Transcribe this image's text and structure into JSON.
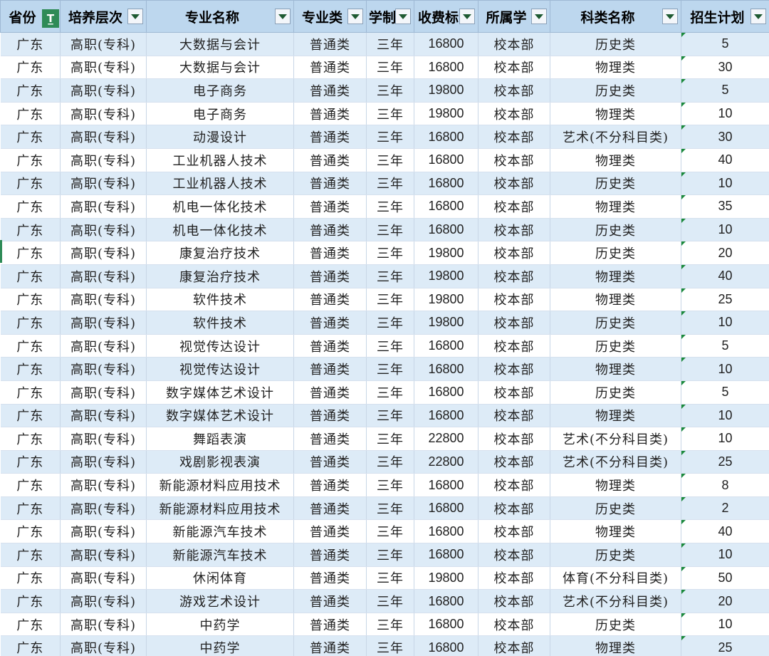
{
  "headers": [
    "省份",
    "培养层次",
    "专业名称",
    "专业类",
    "学制",
    "收费标",
    "所属学",
    "科类名称",
    "招生计划"
  ],
  "rows": [
    [
      "广东",
      "高职(专科)",
      "大数据与会计",
      "普通类",
      "三年",
      "16800",
      "校本部",
      "历史类",
      "5"
    ],
    [
      "广东",
      "高职(专科)",
      "大数据与会计",
      "普通类",
      "三年",
      "16800",
      "校本部",
      "物理类",
      "30"
    ],
    [
      "广东",
      "高职(专科)",
      "电子商务",
      "普通类",
      "三年",
      "19800",
      "校本部",
      "历史类",
      "5"
    ],
    [
      "广东",
      "高职(专科)",
      "电子商务",
      "普通类",
      "三年",
      "19800",
      "校本部",
      "物理类",
      "10"
    ],
    [
      "广东",
      "高职(专科)",
      "动漫设计",
      "普通类",
      "三年",
      "16800",
      "校本部",
      "艺术(不分科目类)",
      "30"
    ],
    [
      "广东",
      "高职(专科)",
      "工业机器人技术",
      "普通类",
      "三年",
      "16800",
      "校本部",
      "物理类",
      "40"
    ],
    [
      "广东",
      "高职(专科)",
      "工业机器人技术",
      "普通类",
      "三年",
      "16800",
      "校本部",
      "历史类",
      "10"
    ],
    [
      "广东",
      "高职(专科)",
      "机电一体化技术",
      "普通类",
      "三年",
      "16800",
      "校本部",
      "物理类",
      "35"
    ],
    [
      "广东",
      "高职(专科)",
      "机电一体化技术",
      "普通类",
      "三年",
      "16800",
      "校本部",
      "历史类",
      "10"
    ],
    [
      "广东",
      "高职(专科)",
      "康复治疗技术",
      "普通类",
      "三年",
      "19800",
      "校本部",
      "历史类",
      "20"
    ],
    [
      "广东",
      "高职(专科)",
      "康复治疗技术",
      "普通类",
      "三年",
      "19800",
      "校本部",
      "物理类",
      "40"
    ],
    [
      "广东",
      "高职(专科)",
      "软件技术",
      "普通类",
      "三年",
      "19800",
      "校本部",
      "物理类",
      "25"
    ],
    [
      "广东",
      "高职(专科)",
      "软件技术",
      "普通类",
      "三年",
      "19800",
      "校本部",
      "历史类",
      "10"
    ],
    [
      "广东",
      "高职(专科)",
      "视觉传达设计",
      "普通类",
      "三年",
      "16800",
      "校本部",
      "历史类",
      "5"
    ],
    [
      "广东",
      "高职(专科)",
      "视觉传达设计",
      "普通类",
      "三年",
      "16800",
      "校本部",
      "物理类",
      "10"
    ],
    [
      "广东",
      "高职(专科)",
      "数字媒体艺术设计",
      "普通类",
      "三年",
      "16800",
      "校本部",
      "历史类",
      "5"
    ],
    [
      "广东",
      "高职(专科)",
      "数字媒体艺术设计",
      "普通类",
      "三年",
      "16800",
      "校本部",
      "物理类",
      "10"
    ],
    [
      "广东",
      "高职(专科)",
      "舞蹈表演",
      "普通类",
      "三年",
      "22800",
      "校本部",
      "艺术(不分科目类)",
      "10"
    ],
    [
      "广东",
      "高职(专科)",
      "戏剧影视表演",
      "普通类",
      "三年",
      "22800",
      "校本部",
      "艺术(不分科目类)",
      "25"
    ],
    [
      "广东",
      "高职(专科)",
      "新能源材料应用技术",
      "普通类",
      "三年",
      "16800",
      "校本部",
      "物理类",
      "8"
    ],
    [
      "广东",
      "高职(专科)",
      "新能源材料应用技术",
      "普通类",
      "三年",
      "16800",
      "校本部",
      "历史类",
      "2"
    ],
    [
      "广东",
      "高职(专科)",
      "新能源汽车技术",
      "普通类",
      "三年",
      "16800",
      "校本部",
      "物理类",
      "40"
    ],
    [
      "广东",
      "高职(专科)",
      "新能源汽车技术",
      "普通类",
      "三年",
      "16800",
      "校本部",
      "历史类",
      "10"
    ],
    [
      "广东",
      "高职(专科)",
      "休闲体育",
      "普通类",
      "三年",
      "19800",
      "校本部",
      "体育(不分科目类)",
      "50"
    ],
    [
      "广东",
      "高职(专科)",
      "游戏艺术设计",
      "普通类",
      "三年",
      "16800",
      "校本部",
      "艺术(不分科目类)",
      "20"
    ],
    [
      "广东",
      "高职(专科)",
      "中药学",
      "普通类",
      "三年",
      "16800",
      "校本部",
      "历史类",
      "10"
    ],
    [
      "广东",
      "高职(专科)",
      "中药学",
      "普通类",
      "三年",
      "16800",
      "校本部",
      "物理类",
      "25"
    ]
  ],
  "colors": {
    "header_bg": "#bdd7ee",
    "band_bg": "#ddebf7",
    "filter_active": "#2e8b57"
  },
  "icons": {
    "active_filter": "filter-active-icon",
    "dropdown": "dropdown-arrow-icon"
  }
}
